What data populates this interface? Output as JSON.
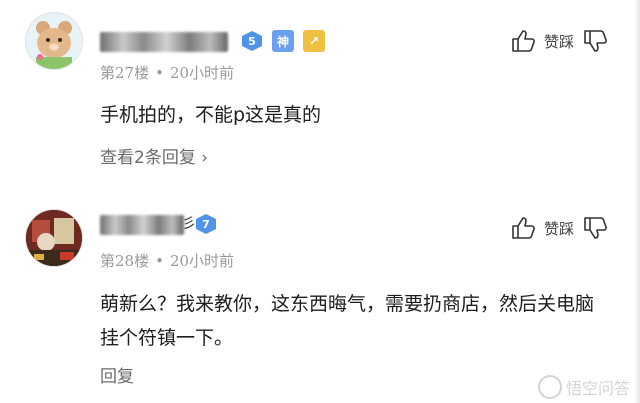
{
  "comments": [
    {
      "level": "5",
      "tag1": "神",
      "tag2": "↗",
      "floor": "第27楼",
      "time": "20小时前",
      "text": "手机拍的，不能p这是真的",
      "reply_link": "查看2条回复",
      "vote_label": "赞踩"
    },
    {
      "name_tail": "彡",
      "level": "7",
      "floor": "第28楼",
      "time": "20小时前",
      "text": "萌新么？我来教你，这东西晦气，需要扔商店，然后关电脑挂个符镇一下。",
      "reply_link": "回复",
      "vote_label": "赞踩"
    }
  ],
  "separator": "•",
  "chevron": "›",
  "watermark": "悟空问答",
  "colors": {
    "level_badge": "#4f94e8",
    "tag_shen": "#6b9ff0",
    "tag_arrow": "#f0c040",
    "meta_text": "#9a9a9a"
  }
}
